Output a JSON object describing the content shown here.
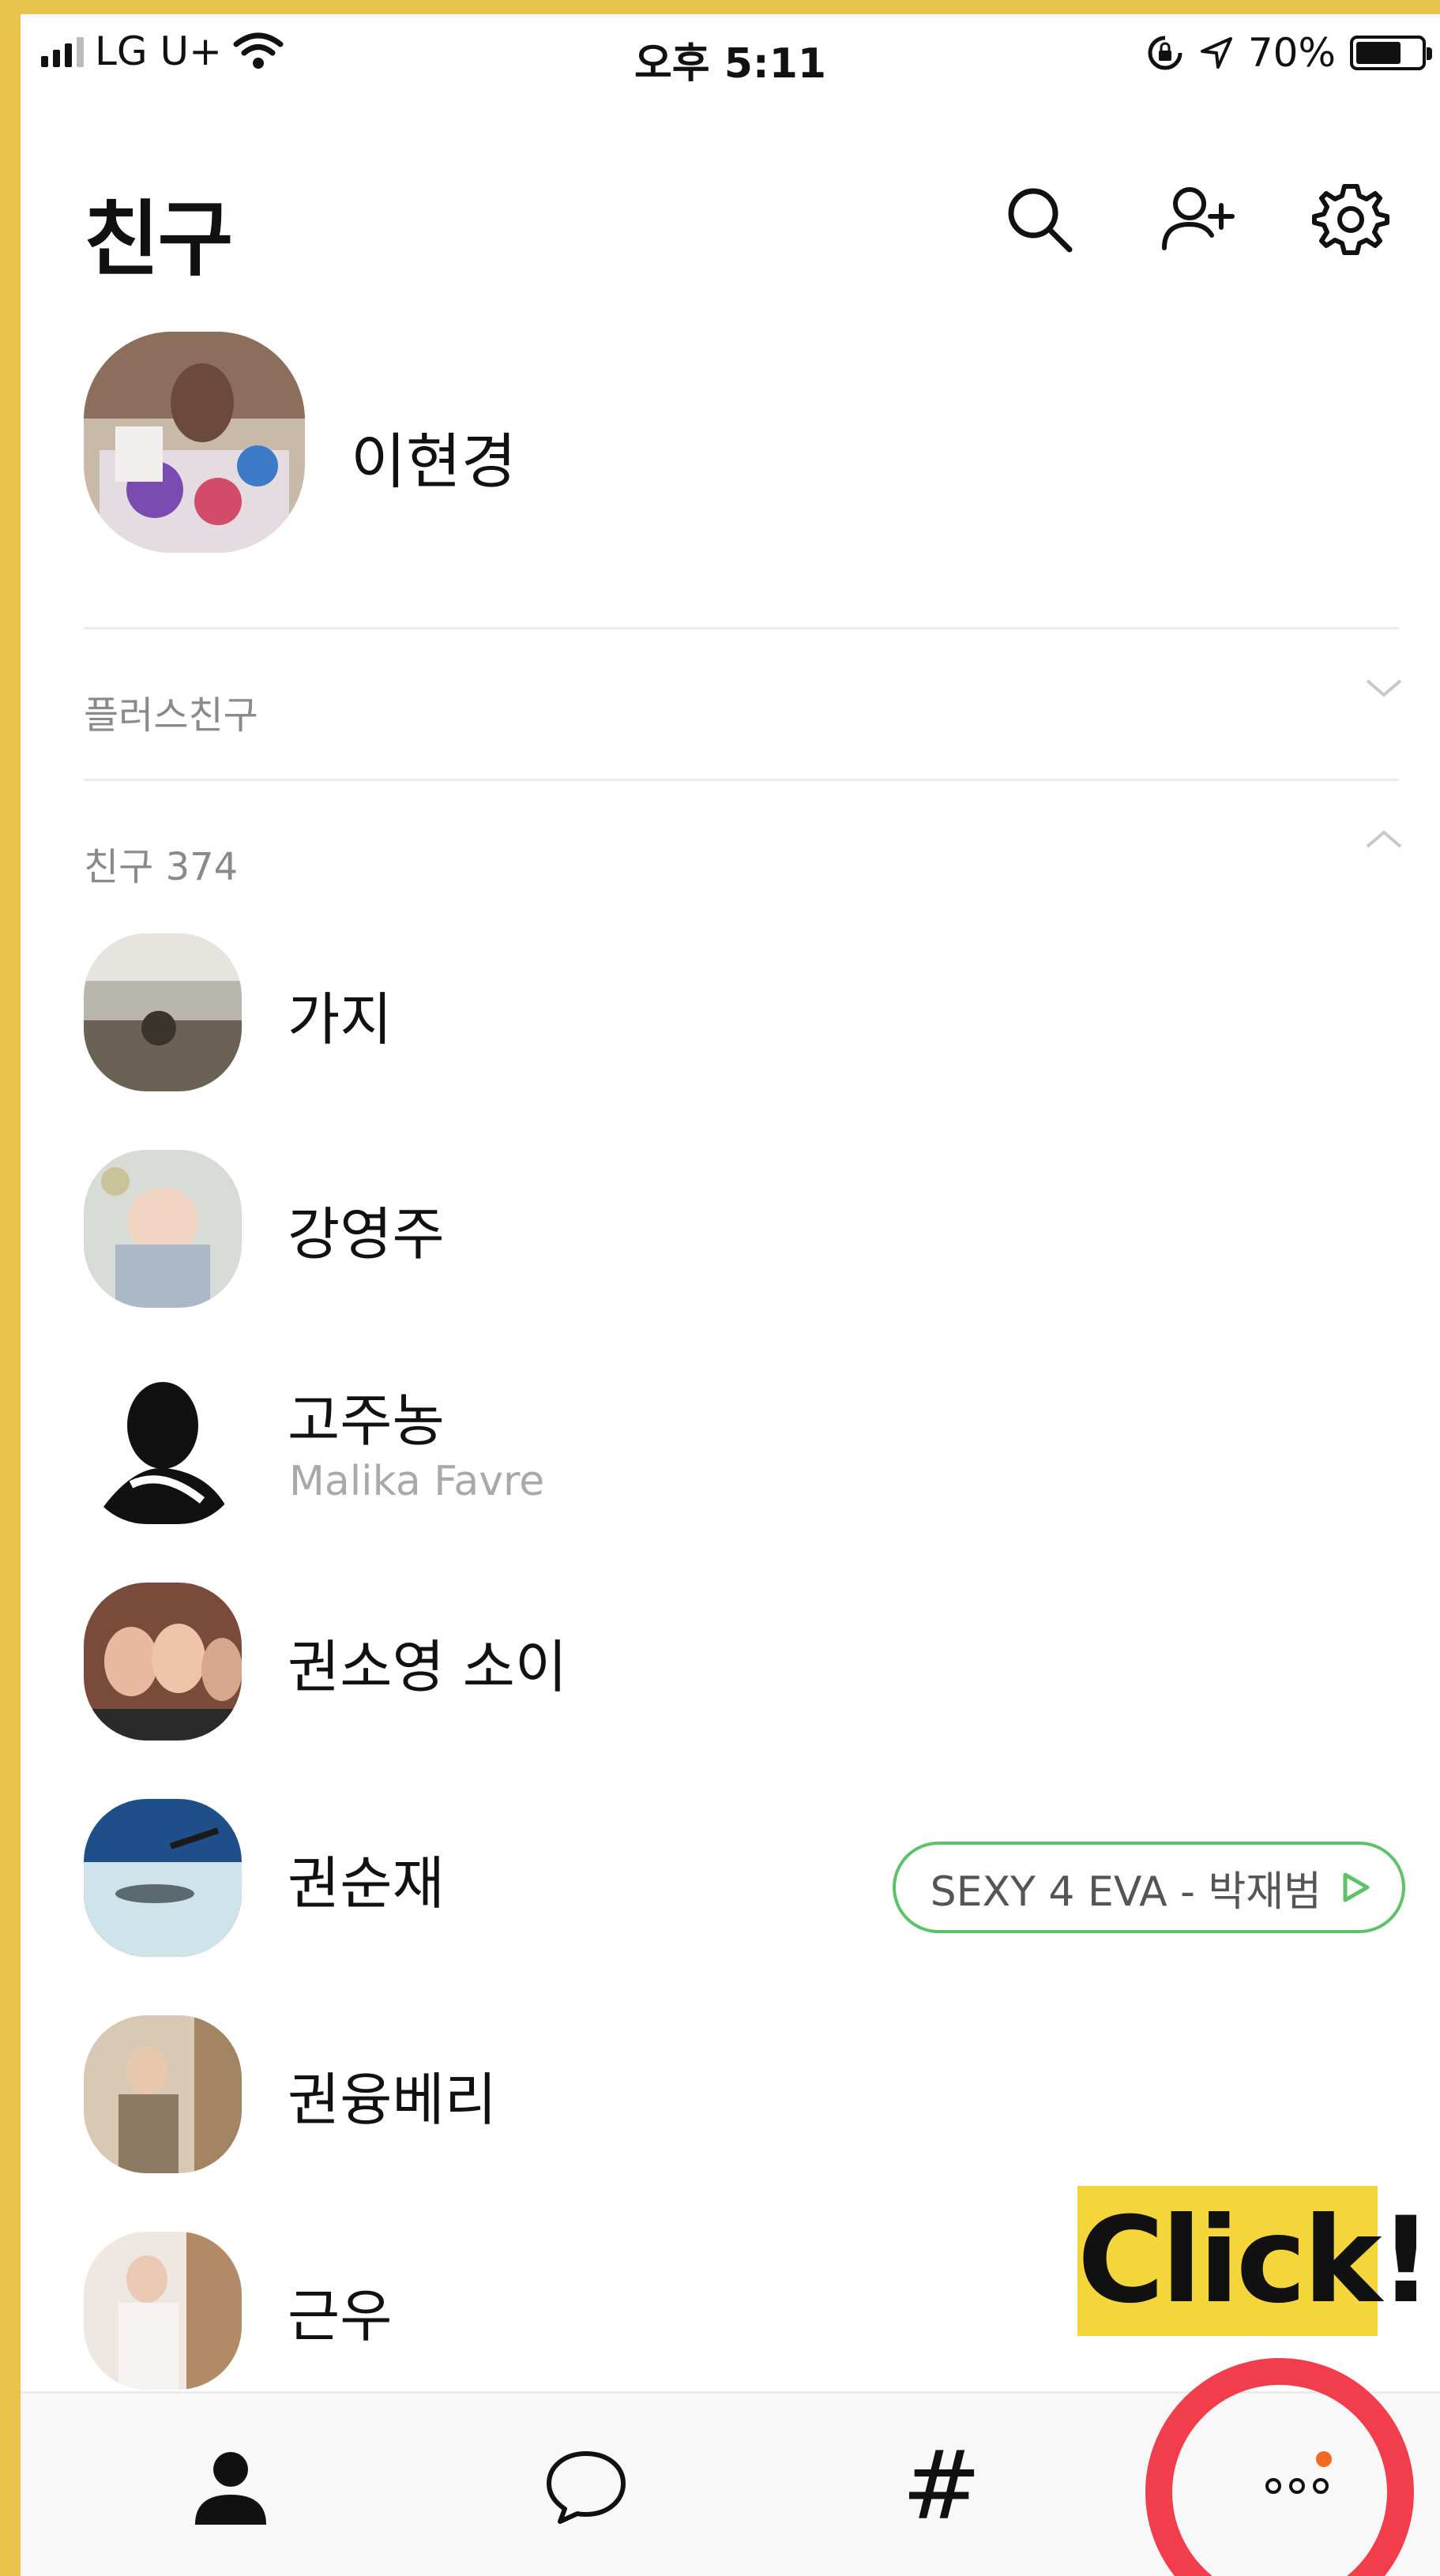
{
  "status_bar": {
    "carrier": "LG U+",
    "time": "오후 5:11",
    "battery_text": "70%",
    "battery_level": 0.7
  },
  "header": {
    "title": "친구"
  },
  "my_profile": {
    "name": "이현경"
  },
  "sections": {
    "plus_friends_label": "플러스친구",
    "friends_label": "친구 374"
  },
  "friends": [
    {
      "name": "가지",
      "status": ""
    },
    {
      "name": "강영주",
      "status": ""
    },
    {
      "name": "고주농",
      "status": "Malika Favre"
    },
    {
      "name": "권소영 소이",
      "status": ""
    },
    {
      "name": "권순재",
      "status": "",
      "music": "SEXY 4 EVA - 박재범"
    },
    {
      "name": "권융베리",
      "status": ""
    },
    {
      "name": "근우",
      "status": ""
    }
  ],
  "callout": {
    "text": "Click!"
  },
  "tabs": {
    "hash_glyph": "#"
  },
  "colors": {
    "frame": "#e9c34e",
    "callout_bg": "#f4d63a",
    "highlight_circle": "#f23d4c",
    "music_border": "#5ec26a",
    "new_dot": "#f26a21"
  }
}
